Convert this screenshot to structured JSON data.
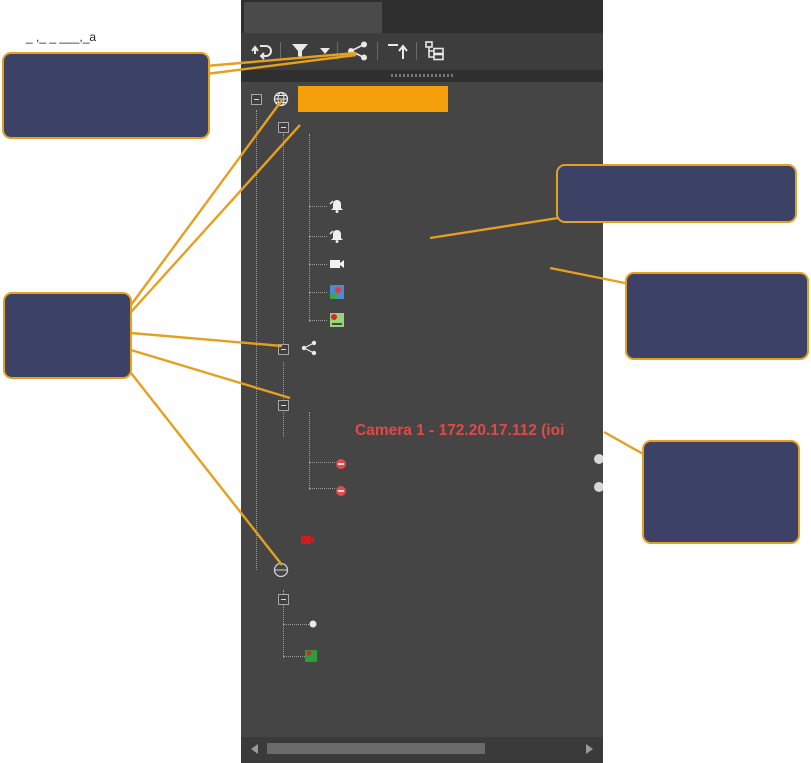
{
  "app_title": "_ ,_ _ ___,_a",
  "panel": {
    "tab_label": "",
    "toolbar": {
      "refresh": "refresh-icon",
      "filter": "filter-icon",
      "filter_dropdown": "chevron-down-icon",
      "share": "share-nodes-icon",
      "collapse": "collapse-up-icon",
      "tree_view": "tree-view-icon"
    }
  },
  "tree": {
    "camera_label": "Camera 1 - 172.20.17.112 (ioi"
  },
  "colors": {
    "panel_bg": "#454545",
    "selected_item": "#f5a00a",
    "callout_fill": "#3b4265",
    "callout_border": "#e5a020",
    "error_text": "#e24848"
  }
}
